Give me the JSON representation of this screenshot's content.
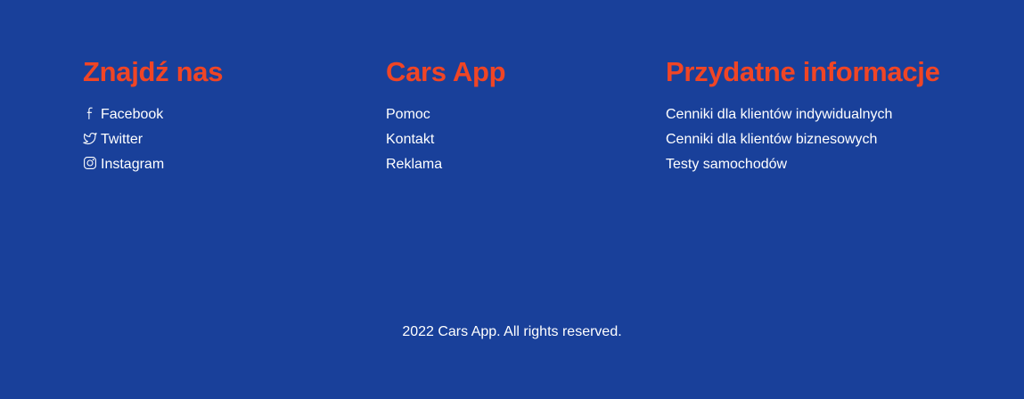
{
  "find_us": {
    "heading": "Znajdź nas",
    "items": [
      {
        "label": "Facebook",
        "icon": "facebook-icon"
      },
      {
        "label": "Twitter",
        "icon": "twitter-icon"
      },
      {
        "label": "Instagram",
        "icon": "instagram-icon"
      }
    ]
  },
  "cars_app": {
    "heading": "Cars App",
    "items": [
      {
        "label": "Pomoc"
      },
      {
        "label": "Kontakt"
      },
      {
        "label": "Reklama"
      }
    ]
  },
  "useful_info": {
    "heading": "Przydatne informacje",
    "items": [
      {
        "label": "Cenniki dla klientów indywidualnych"
      },
      {
        "label": "Cenniki dla klientów biznesowych"
      },
      {
        "label": "Testy samochodów"
      }
    ]
  },
  "copyright": "2022 Cars App. All rights reserved.",
  "colors": {
    "background": "#19409a",
    "heading": "#f04525",
    "text": "#ffffff"
  }
}
